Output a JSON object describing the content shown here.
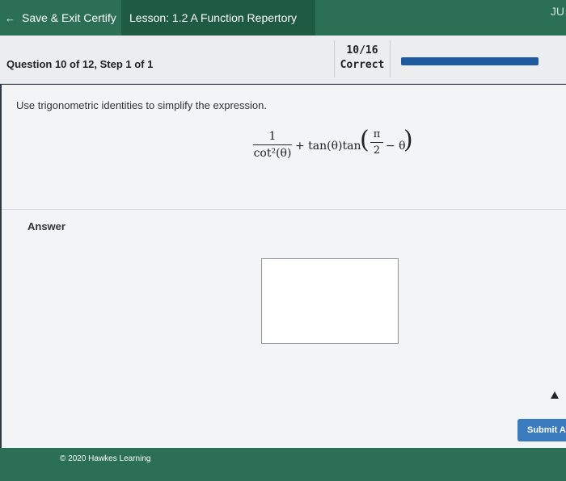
{
  "top_bar": {
    "exit_label": "Save & Exit Certify",
    "lesson_label": "Lesson: 1.2 A Function Repertory",
    "user_initials": "JU"
  },
  "question_header": {
    "title": "Question 10 of 12, Step 1 of 1",
    "score": "10/16",
    "status": "Correct",
    "progress_percent": 100
  },
  "question": {
    "prompt": "Use trigonometric identities to simplify the expression.",
    "expression": {
      "term1_numerator": "1",
      "term1_denominator": "cot²(θ)",
      "middle": "+ tan(θ)tan",
      "inner_numerator": "π",
      "inner_denominator": "2",
      "inner_tail": "− θ"
    }
  },
  "answer": {
    "label": "Answer",
    "value": ""
  },
  "actions": {
    "submit_label": "Submit A"
  },
  "footer": {
    "copyright": "© 2020 Hawkes Learning"
  },
  "colors": {
    "header_green": "#2b6f54",
    "progress_blue": "#1e5aa0",
    "submit_blue": "#3a7bbd"
  }
}
